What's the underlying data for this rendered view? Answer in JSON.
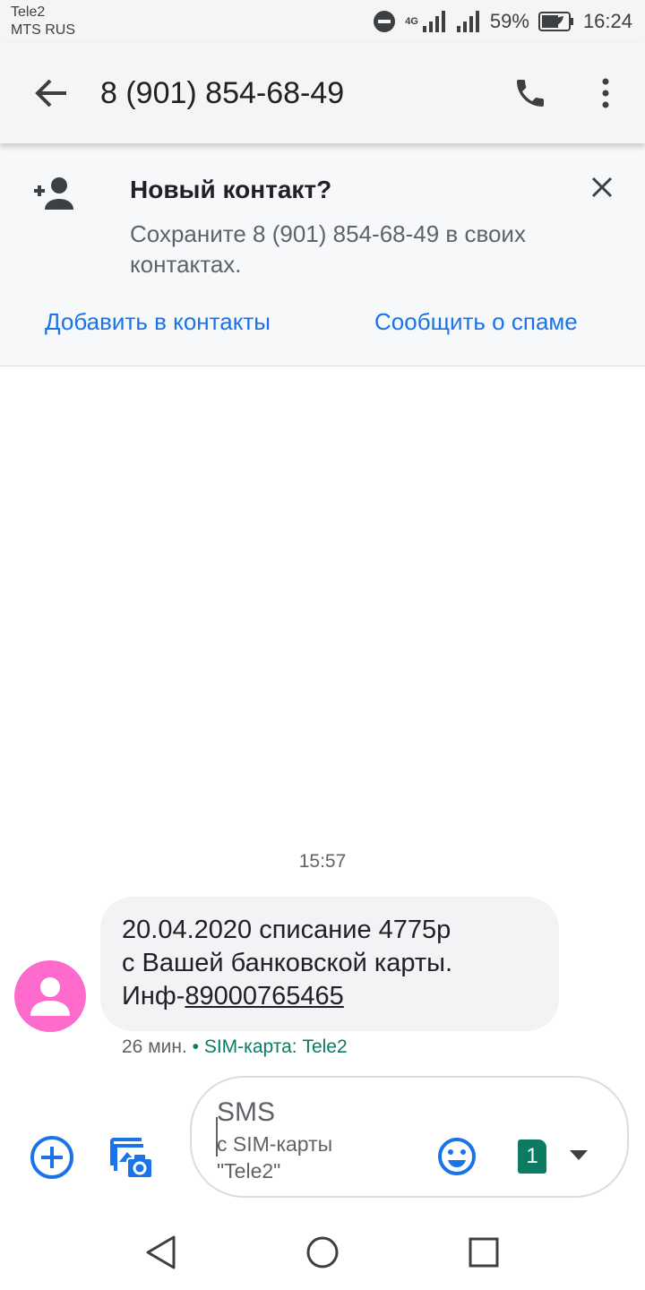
{
  "status_bar": {
    "carrier_1": "Tele2",
    "carrier_2": "MTS RUS",
    "network_type": "4G",
    "battery": "59%",
    "time": "16:24"
  },
  "app_bar": {
    "title": "8 (901) 854-68-49"
  },
  "banner": {
    "title": "Новый контакт?",
    "text": "Сохраните 8 (901) 854-68-49 в своих контактах.",
    "add_contact": "Добавить в контакты",
    "report_spam": "Сообщить о спаме"
  },
  "conversation": {
    "timestamp": "15:57",
    "message": {
      "line1": "20.04.2020 списание 4775р",
      "line2": "с Вашей банковской карты.",
      "line3_prefix": "Инф-",
      "line3_phone": "89000765465",
      "age": "26 мин.",
      "separator": "•",
      "sim": "SIM-карта: Tele2"
    }
  },
  "compose": {
    "hint": "SMS",
    "sim_hint_1": "с SIM-карты",
    "sim_hint_2": "\"Tele2\"",
    "sim_number": "1"
  },
  "colors": {
    "accent": "#1a73e8",
    "sim_green": "#0d7a64",
    "avatar": "#ff6bcd",
    "bubble": "#f1f3f4"
  },
  "icons": [
    "back-arrow-icon",
    "phone-icon",
    "more-vert-icon",
    "add-person-icon",
    "close-icon",
    "person-icon",
    "add-circle-icon",
    "gallery-camera-icon",
    "emoji-icon",
    "dropdown-arrow-icon",
    "nav-back-icon",
    "nav-home-icon",
    "nav-recents-icon"
  ]
}
